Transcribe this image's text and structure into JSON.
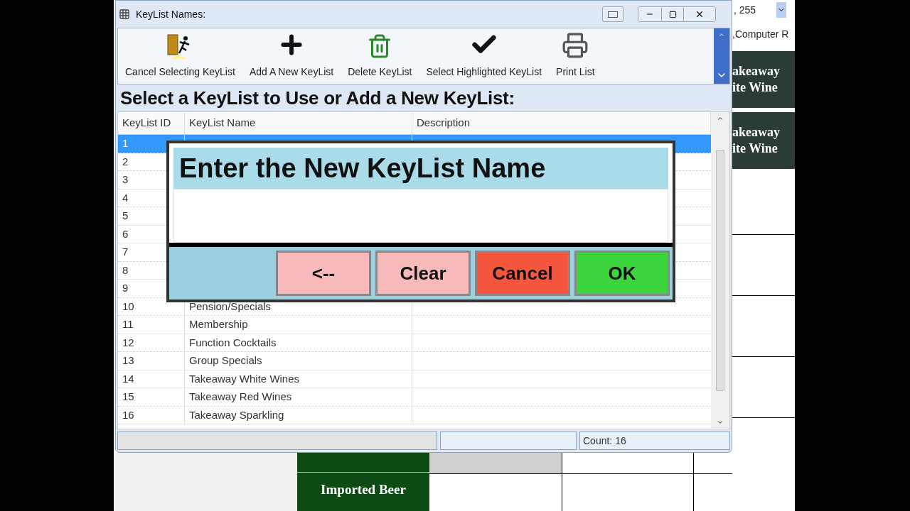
{
  "background": {
    "field_value": ", 255",
    "label": ",Computer R",
    "tiles": [
      {
        "lines": [
          "akeaway",
          "ite Wine"
        ]
      },
      {
        "lines": [
          "akeaway",
          "ite Wine"
        ]
      }
    ],
    "bottom_tile": "Imported Beer"
  },
  "window": {
    "title": "KeyList Names:"
  },
  "toolbar": [
    {
      "label": "Cancel Selecting KeyList",
      "kind": "exit"
    },
    {
      "label": "Add A New KeyList",
      "kind": "add"
    },
    {
      "label": "Delete KeyList",
      "kind": "delete"
    },
    {
      "label": "Select Highlighted KeyList",
      "kind": "select"
    },
    {
      "label": "Print List",
      "kind": "print"
    }
  ],
  "heading": "Select a KeyList to Use or Add a New KeyList:",
  "table": {
    "columns": [
      "KeyList ID",
      "KeyList Name",
      "Description"
    ],
    "rows": [
      {
        "number": "1",
        "selected": true
      },
      {
        "number": "2",
        "selected": false
      },
      {
        "number": "3",
        "selected": false
      },
      {
        "number": "4",
        "selected": false
      },
      {
        "number": "5",
        "selected": false
      },
      {
        "number": "6",
        "selected": false
      },
      {
        "number": "7",
        "selected": false
      },
      {
        "number": "8",
        "selected": false
      },
      {
        "number": "9",
        "selected": false
      },
      {
        "number": "10",
        "name": "Pension/Specials",
        "selected": false
      },
      {
        "number": "11",
        "name": "Membership",
        "selected": false
      },
      {
        "number": "12",
        "name": "Function Cocktails",
        "selected": false
      },
      {
        "number": "13",
        "name": "Group Specials",
        "selected": false
      },
      {
        "number": "14",
        "name": "Takeaway White Wines",
        "selected": false
      },
      {
        "number": "15",
        "name": "Takeaway Red Wines",
        "selected": false
      },
      {
        "number": "16",
        "name": "Takeaway Sparkling",
        "selected": false
      }
    ]
  },
  "status_bar": {
    "count": "Count: 16"
  },
  "dialog": {
    "title": "Enter the New KeyList Name",
    "buttons": [
      {
        "label": "<--",
        "kind": "back"
      },
      {
        "label": "Clear",
        "kind": "clear"
      },
      {
        "label": "Cancel",
        "kind": "cancel"
      },
      {
        "label": "OK",
        "kind": "ok"
      }
    ]
  }
}
